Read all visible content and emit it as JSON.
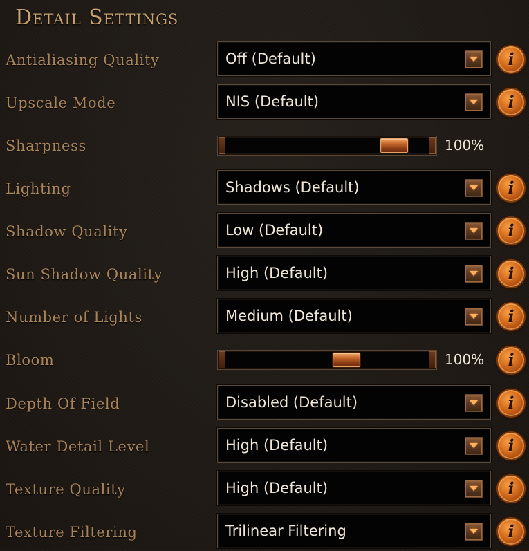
{
  "panel": {
    "title": "Detail Settings"
  },
  "settings": [
    {
      "label": "Antialiasing Quality",
      "type": "select",
      "value": "Off (Default)",
      "info": true
    },
    {
      "label": "Upscale Mode",
      "type": "select",
      "value": "NIS (Default)",
      "info": true
    },
    {
      "label": "Sharpness",
      "type": "slider",
      "value": "100%",
      "level": 0.88,
      "info": false
    },
    {
      "label": "Lighting",
      "type": "select",
      "value": "Shadows (Default)",
      "info": true
    },
    {
      "label": "Shadow Quality",
      "type": "select",
      "value": "Low (Default)",
      "info": true
    },
    {
      "label": "Sun Shadow Quality",
      "type": "select",
      "value": "High (Default)",
      "info": true
    },
    {
      "label": "Number of Lights",
      "type": "select",
      "value": "Medium (Default)",
      "info": true
    },
    {
      "label": "Bloom",
      "type": "slider",
      "value": "100%",
      "level": 0.61,
      "info": true
    },
    {
      "label": "Depth Of Field",
      "type": "select",
      "value": "Disabled (Default)",
      "info": true
    },
    {
      "label": "Water Detail Level",
      "type": "select",
      "value": "High (Default)",
      "info": true
    },
    {
      "label": "Texture Quality",
      "type": "select",
      "value": "High (Default)",
      "info": true
    },
    {
      "label": "Texture Filtering",
      "type": "select",
      "value": "Trilinear Filtering",
      "info": true
    }
  ],
  "icons": {
    "dropdown": "chevron-down-icon",
    "info": "info-icon",
    "info_glyph": "i"
  },
  "colors": {
    "background": "#1f1a16",
    "title": "#c9a271",
    "label": "#a8845b",
    "value": "#efe6d8",
    "accent": "#d8701e"
  }
}
